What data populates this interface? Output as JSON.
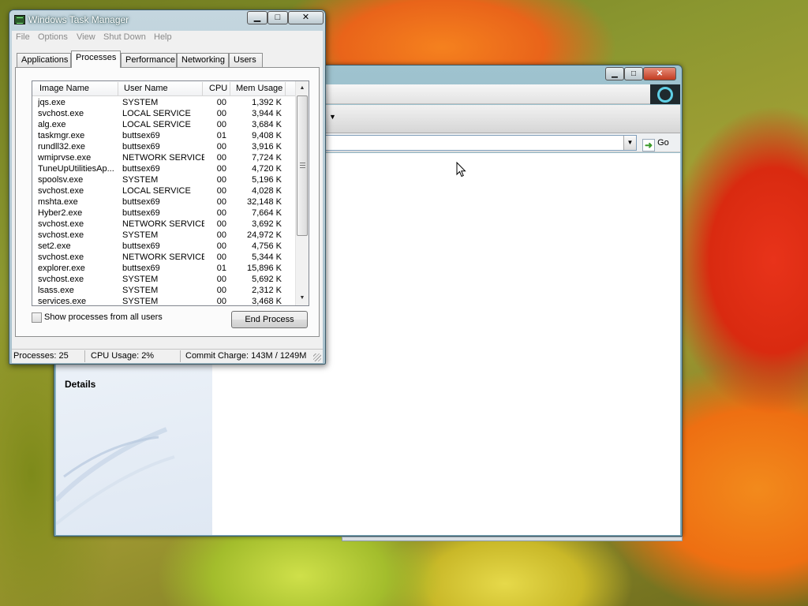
{
  "task_manager": {
    "title": "Windows Task Manager",
    "menu": [
      "File",
      "Options",
      "View",
      "Shut Down",
      "Help"
    ],
    "tabs": [
      "Applications",
      "Processes",
      "Performance",
      "Networking",
      "Users"
    ],
    "active_tab": "Processes",
    "columns": [
      "Image Name",
      "User Name",
      "CPU",
      "Mem Usage"
    ],
    "processes": [
      {
        "image": "jqs.exe",
        "user": "SYSTEM",
        "cpu": "00",
        "mem": "1,392 K"
      },
      {
        "image": "svchost.exe",
        "user": "LOCAL SERVICE",
        "cpu": "00",
        "mem": "3,944 K"
      },
      {
        "image": "alg.exe",
        "user": "LOCAL SERVICE",
        "cpu": "00",
        "mem": "3,684 K"
      },
      {
        "image": "taskmgr.exe",
        "user": "buttsex69",
        "cpu": "01",
        "mem": "9,408 K"
      },
      {
        "image": "rundll32.exe",
        "user": "buttsex69",
        "cpu": "00",
        "mem": "3,916 K"
      },
      {
        "image": "wmiprvse.exe",
        "user": "NETWORK SERVICE",
        "cpu": "00",
        "mem": "7,724 K"
      },
      {
        "image": "TuneUpUtilitiesAp...",
        "user": "buttsex69",
        "cpu": "00",
        "mem": "4,720 K"
      },
      {
        "image": "spoolsv.exe",
        "user": "SYSTEM",
        "cpu": "00",
        "mem": "5,196 K"
      },
      {
        "image": "svchost.exe",
        "user": "LOCAL SERVICE",
        "cpu": "00",
        "mem": "4,028 K"
      },
      {
        "image": "mshta.exe",
        "user": "buttsex69",
        "cpu": "00",
        "mem": "32,148 K"
      },
      {
        "image": "Hyber2.exe",
        "user": "buttsex69",
        "cpu": "00",
        "mem": "7,664 K"
      },
      {
        "image": "svchost.exe",
        "user": "NETWORK SERVICE",
        "cpu": "00",
        "mem": "3,692 K"
      },
      {
        "image": "svchost.exe",
        "user": "SYSTEM",
        "cpu": "00",
        "mem": "24,972 K"
      },
      {
        "image": "set2.exe",
        "user": "buttsex69",
        "cpu": "00",
        "mem": "4,756 K"
      },
      {
        "image": "svchost.exe",
        "user": "NETWORK SERVICE",
        "cpu": "00",
        "mem": "5,344 K"
      },
      {
        "image": "explorer.exe",
        "user": "buttsex69",
        "cpu": "01",
        "mem": "15,896 K"
      },
      {
        "image": "svchost.exe",
        "user": "SYSTEM",
        "cpu": "00",
        "mem": "5,692 K"
      },
      {
        "image": "lsass.exe",
        "user": "SYSTEM",
        "cpu": "00",
        "mem": "2,312 K"
      },
      {
        "image": "services.exe",
        "user": "SYSTEM",
        "cpu": "00",
        "mem": "3,468 K"
      }
    ],
    "show_all_label": "Show processes from all users",
    "end_process_label": "End Process",
    "status": {
      "processes": "Processes: 25",
      "cpu": "CPU Usage: 2%",
      "commit": "Commit Charge: 143M / 1249M"
    }
  },
  "browser": {
    "go_label": "Go",
    "sidebar_heading": "Details"
  },
  "icons": {
    "go": "go-arrow-icon",
    "close": "close-icon",
    "minimize": "minimize-icon",
    "maximize": "maximize-icon"
  }
}
